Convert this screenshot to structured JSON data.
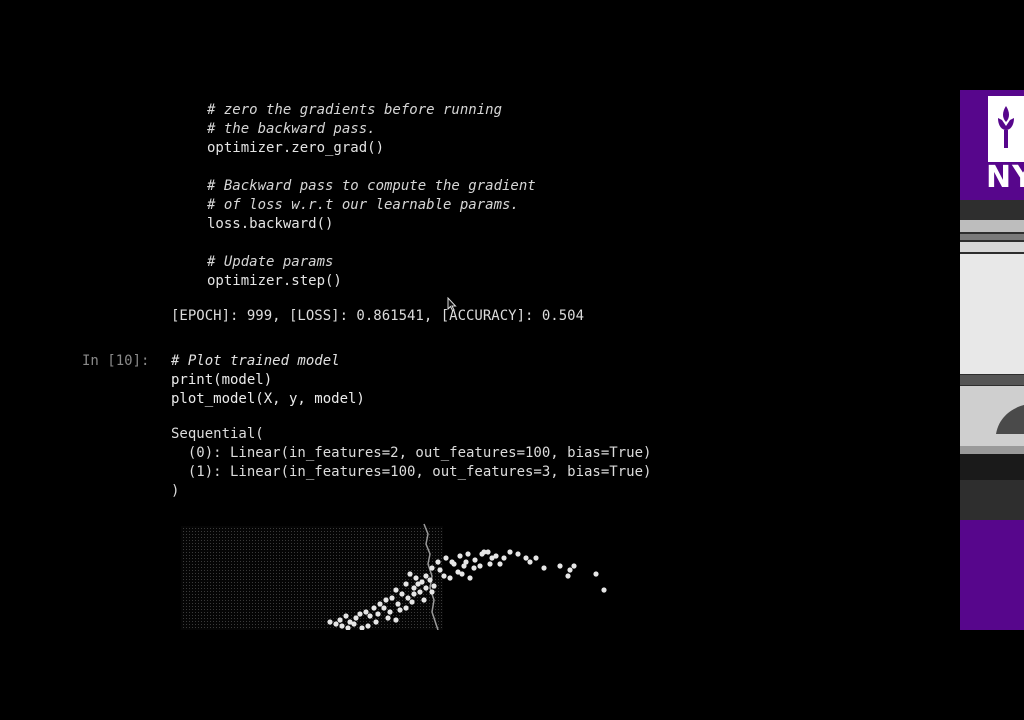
{
  "code_block_lines": [
    {
      "text": "# zero the gradients before running",
      "kind": "comment"
    },
    {
      "text": "# the backward pass.",
      "kind": "comment"
    },
    {
      "text": "optimizer.zero_grad()",
      "kind": "code"
    },
    {
      "text": "",
      "kind": "blank"
    },
    {
      "text": "# Backward pass to compute the gradient",
      "kind": "comment"
    },
    {
      "text": "# of loss w.r.t our learnable params.",
      "kind": "comment"
    },
    {
      "text": "loss.backward()",
      "kind": "code"
    },
    {
      "text": "",
      "kind": "blank"
    },
    {
      "text": "# Update params",
      "kind": "comment"
    },
    {
      "text": "optimizer.step()",
      "kind": "code"
    }
  ],
  "training_output": "[EPOCH]: 999, [LOSS]: 0.861541, [ACCURACY]: 0.504",
  "cell": {
    "prompt": "In [10]:",
    "lines": [
      {
        "text": "# Plot trained model",
        "kind": "comment"
      },
      {
        "text": "print(model)",
        "kind": "code"
      },
      {
        "text": "plot_model(X, y, model)",
        "kind": "code"
      }
    ]
  },
  "model_output": [
    "Sequential(",
    "  (0): Linear(in_features=2, out_features=100, bias=True)",
    "  (1): Linear(in_features=100, out_features=3, bias=True)",
    ")"
  ],
  "side_panel": {
    "logo_text": "NY",
    "brand_color": "#57068c"
  },
  "icons": {
    "cursor": "mouse-pointer-icon",
    "logo": "torch-icon"
  }
}
